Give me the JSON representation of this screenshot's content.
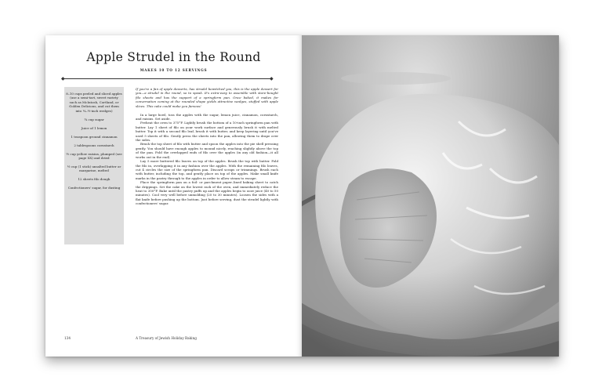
{
  "recipe": {
    "title": "Apple Strudel in the Round",
    "yield": "MAKES 10 TO 12 SERVINGS"
  },
  "ingredients": [
    "8–10 cups peeled and sliced apples (use a semi-tart, sweet variety such as McIntosh, Cortland, or Golden Delicious, and cut them into ¼–½-inch wedges)",
    "¾ cup sugar",
    "Juice of 1 lemon",
    "1 teaspoon ground cinnamon",
    "2 tablespoons cornstarch",
    "½ cup yellow raisins, plumped (see page XX) and dried",
    "½ cup (1 stick) unsalted butter or margarine, melted",
    "12 sheets filo dough",
    "Confectioners' sugar, for dusting"
  ],
  "intro": "If you're a fan of apple desserts, has strudel bewitched you, this is the apple dessert for you—a strudel in the round, so to speak. It's extra-easy to assemble with store-bought filo sheets and has the support of a springform pan. Once baked, it makes for conversation coming at the rounded shape yields attractive wedges, stuffed with apple slices. This cake could make you famous!",
  "method": [
    "In a large bowl, toss the apples with the sugar, lemon juice, cinnamon, cornstarch, and raisins. Set aside.",
    "Preheat the oven to 375°F. Lightly brush the bottom of a 10-inch springform pan with butter. Lay 1 sheet of filo on your work surface and generously brush it with melted butter. Top it with a second filo leaf, brush it with butter, and keep layering until you've used 5 sheets of filo. Gently press the sheets into the pan, allowing them to drape over the sides.",
    "Brush the top sheet of filo with butter and spoon the apples into the pie shell pressing gently. You should have enough apples to mound nicely, reaching slightly above the top of the pan. Fold the overlapped ends of filo over the apples (in any old fashion—it all works out in the end).",
    "Lay 5 more buttered filo leaves on top of the apples. Brush the top with butter. Fold the filo in, overlapping it in any fashion over the apples. With the remaining filo leaves, cut 4 circles the size of the springform pan. Discard scraps or trimmings. Brush each with butter, including the top, and gently place on top of the apples. Make small knife marks in the pastry through to the apples in order to allow steam to escape.",
    "Place the springform pan on a foil- or parchment paper–lined baking sheet to catch the drippings. Set the cake on the lowest rack of the oven, and immediately reduce the heat to 350°F. Bake until the pastry puffs up and the apples begin to ooze juice (40 to 50 minutes). Cool very well before unmolding (20 to 30 minutes). Loosen the sides with a flat knife before pushing up the bottom. Just before serving, dust the strudel lightly with confectioners' sugar."
  ],
  "folio": {
    "page_number": "134",
    "running_title": "A Treasury of Jewish Holiday Baking"
  },
  "photo": {
    "description_icon": "photo-icon"
  }
}
